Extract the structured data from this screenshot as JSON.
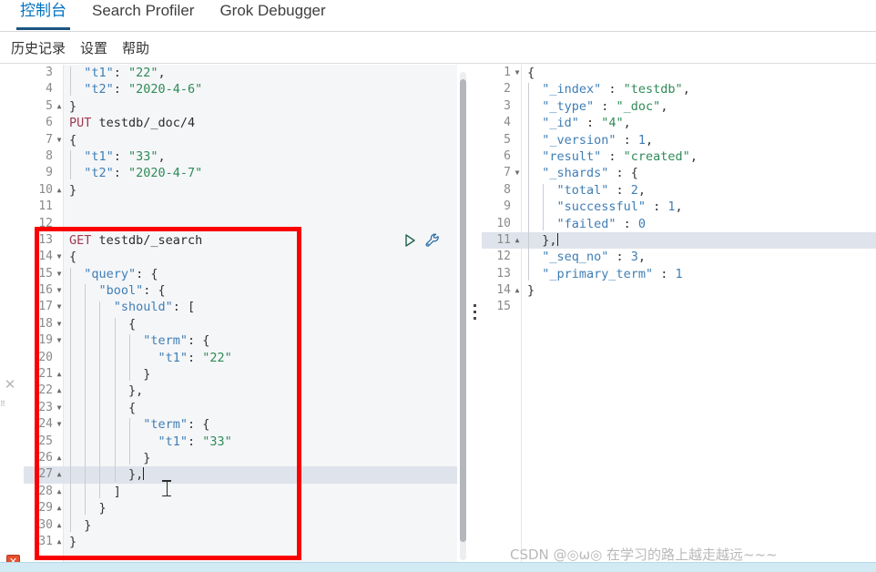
{
  "topbar": {
    "tabs": [
      {
        "label": "控制台",
        "active": true
      },
      {
        "label": "Search Profiler",
        "active": false
      },
      {
        "label": "Grok Debugger",
        "active": false
      }
    ]
  },
  "menubar": {
    "items": [
      {
        "label": "历史记录"
      },
      {
        "label": "设置"
      },
      {
        "label": "帮助"
      }
    ]
  },
  "editor_left": {
    "name": "request-editor",
    "actions": {
      "play": "play-request-icon",
      "wrench": "wrench-settings-icon"
    },
    "error_marker": "✕",
    "close_marker": "✕",
    "highlighted_line": 27,
    "cursor_line": 27,
    "lines": [
      {
        "num": 3,
        "fold": "",
        "indent": 1,
        "tokens": [
          {
            "t": "\"t1\"",
            "c": "k-key"
          },
          {
            "t": ": ",
            "c": "k-punc"
          },
          {
            "t": "\"22\"",
            "c": "k-str"
          },
          {
            "t": ",",
            "c": "k-punc"
          }
        ]
      },
      {
        "num": 4,
        "fold": "",
        "indent": 1,
        "tokens": [
          {
            "t": "\"t2\"",
            "c": "k-key"
          },
          {
            "t": ": ",
            "c": "k-punc"
          },
          {
            "t": "\"2020-4-6\"",
            "c": "k-str"
          }
        ]
      },
      {
        "num": 5,
        "fold": "▲",
        "indent": 0,
        "tokens": [
          {
            "t": "}",
            "c": "k-punc"
          }
        ]
      },
      {
        "num": 6,
        "fold": "",
        "indent": 0,
        "tokens": [
          {
            "t": "PUT",
            "c": "k-method"
          },
          {
            "t": " testdb/_doc/4",
            "c": "k-url"
          }
        ]
      },
      {
        "num": 7,
        "fold": "▼",
        "indent": 0,
        "tokens": [
          {
            "t": "{",
            "c": "k-punc"
          }
        ]
      },
      {
        "num": 8,
        "fold": "",
        "indent": 1,
        "tokens": [
          {
            "t": "\"t1\"",
            "c": "k-key"
          },
          {
            "t": ": ",
            "c": "k-punc"
          },
          {
            "t": "\"33\"",
            "c": "k-str"
          },
          {
            "t": ",",
            "c": "k-punc"
          }
        ]
      },
      {
        "num": 9,
        "fold": "",
        "indent": 1,
        "tokens": [
          {
            "t": "\"t2\"",
            "c": "k-key"
          },
          {
            "t": ": ",
            "c": "k-punc"
          },
          {
            "t": "\"2020-4-7\"",
            "c": "k-str"
          }
        ]
      },
      {
        "num": 10,
        "fold": "▲",
        "indent": 0,
        "tokens": [
          {
            "t": "}",
            "c": "k-punc"
          }
        ]
      },
      {
        "num": 11,
        "fold": "",
        "indent": 0,
        "tokens": []
      },
      {
        "num": 12,
        "fold": "",
        "indent": 0,
        "tokens": []
      },
      {
        "num": 13,
        "fold": "",
        "indent": 0,
        "tokens": [
          {
            "t": "GET",
            "c": "k-method"
          },
          {
            "t": " testdb/_search",
            "c": "k-url"
          }
        ]
      },
      {
        "num": 14,
        "fold": "▼",
        "indent": 0,
        "tokens": [
          {
            "t": "{",
            "c": "k-punc"
          }
        ]
      },
      {
        "num": 15,
        "fold": "▼",
        "indent": 1,
        "tokens": [
          {
            "t": "\"query\"",
            "c": "k-key"
          },
          {
            "t": ": {",
            "c": "k-punc"
          }
        ]
      },
      {
        "num": 16,
        "fold": "▼",
        "indent": 2,
        "tokens": [
          {
            "t": "\"bool\"",
            "c": "k-key"
          },
          {
            "t": ": {",
            "c": "k-punc"
          }
        ]
      },
      {
        "num": 17,
        "fold": "▼",
        "indent": 3,
        "tokens": [
          {
            "t": "\"should\"",
            "c": "k-key"
          },
          {
            "t": ": [",
            "c": "k-punc"
          }
        ]
      },
      {
        "num": 18,
        "fold": "▼",
        "indent": 4,
        "tokens": [
          {
            "t": "{",
            "c": "k-punc"
          }
        ]
      },
      {
        "num": 19,
        "fold": "▼",
        "indent": 5,
        "tokens": [
          {
            "t": "\"term\"",
            "c": "k-key"
          },
          {
            "t": ": {",
            "c": "k-punc"
          }
        ]
      },
      {
        "num": 20,
        "fold": "",
        "indent": 6,
        "tokens": [
          {
            "t": "\"t1\"",
            "c": "k-key"
          },
          {
            "t": ": ",
            "c": "k-punc"
          },
          {
            "t": "\"22\"",
            "c": "k-str"
          }
        ]
      },
      {
        "num": 21,
        "fold": "▲",
        "indent": 5,
        "tokens": [
          {
            "t": "}",
            "c": "k-punc"
          }
        ]
      },
      {
        "num": 22,
        "fold": "▲",
        "indent": 4,
        "tokens": [
          {
            "t": "},",
            "c": "k-punc"
          }
        ]
      },
      {
        "num": 23,
        "fold": "▼",
        "indent": 4,
        "tokens": [
          {
            "t": "{",
            "c": "k-punc"
          }
        ]
      },
      {
        "num": 24,
        "fold": "▼",
        "indent": 5,
        "tokens": [
          {
            "t": "\"term\"",
            "c": "k-key"
          },
          {
            "t": ": {",
            "c": "k-punc"
          }
        ]
      },
      {
        "num": 25,
        "fold": "",
        "indent": 6,
        "tokens": [
          {
            "t": "\"t1\"",
            "c": "k-key"
          },
          {
            "t": ": ",
            "c": "k-punc"
          },
          {
            "t": "\"33\"",
            "c": "k-str"
          }
        ]
      },
      {
        "num": 26,
        "fold": "▲",
        "indent": 5,
        "tokens": [
          {
            "t": "}",
            "c": "k-punc"
          }
        ]
      },
      {
        "num": 27,
        "fold": "▲",
        "indent": 4,
        "tokens": [
          {
            "t": "},",
            "c": "k-punc"
          }
        ]
      },
      {
        "num": 28,
        "fold": "▲",
        "indent": 3,
        "tokens": [
          {
            "t": "]",
            "c": "k-punc"
          }
        ]
      },
      {
        "num": 29,
        "fold": "▲",
        "indent": 2,
        "tokens": [
          {
            "t": "}",
            "c": "k-punc"
          }
        ]
      },
      {
        "num": 30,
        "fold": "▲",
        "indent": 1,
        "tokens": [
          {
            "t": "}",
            "c": "k-punc"
          }
        ]
      },
      {
        "num": 31,
        "fold": "▲",
        "indent": 0,
        "tokens": [
          {
            "t": "}",
            "c": "k-punc"
          }
        ]
      }
    ]
  },
  "editor_right": {
    "name": "response-viewer",
    "highlighted_line": 11,
    "lines": [
      {
        "num": 1,
        "fold": "▼",
        "indent": 0,
        "tokens": [
          {
            "t": "{",
            "c": "k-punc"
          }
        ]
      },
      {
        "num": 2,
        "fold": "",
        "indent": 1,
        "tokens": [
          {
            "t": "\"_index\"",
            "c": "k-key"
          },
          {
            "t": " : ",
            "c": "k-punc"
          },
          {
            "t": "\"testdb\"",
            "c": "k-str"
          },
          {
            "t": ",",
            "c": "k-punc"
          }
        ]
      },
      {
        "num": 3,
        "fold": "",
        "indent": 1,
        "tokens": [
          {
            "t": "\"_type\"",
            "c": "k-key"
          },
          {
            "t": " : ",
            "c": "k-punc"
          },
          {
            "t": "\"_doc\"",
            "c": "k-str"
          },
          {
            "t": ",",
            "c": "k-punc"
          }
        ]
      },
      {
        "num": 4,
        "fold": "",
        "indent": 1,
        "tokens": [
          {
            "t": "\"_id\"",
            "c": "k-key"
          },
          {
            "t": " : ",
            "c": "k-punc"
          },
          {
            "t": "\"4\"",
            "c": "k-str"
          },
          {
            "t": ",",
            "c": "k-punc"
          }
        ]
      },
      {
        "num": 5,
        "fold": "",
        "indent": 1,
        "tokens": [
          {
            "t": "\"_version\"",
            "c": "k-key"
          },
          {
            "t": " : ",
            "c": "k-punc"
          },
          {
            "t": "1",
            "c": "k-num"
          },
          {
            "t": ",",
            "c": "k-punc"
          }
        ]
      },
      {
        "num": 6,
        "fold": "",
        "indent": 1,
        "tokens": [
          {
            "t": "\"result\"",
            "c": "k-key"
          },
          {
            "t": " : ",
            "c": "k-punc"
          },
          {
            "t": "\"created\"",
            "c": "k-str"
          },
          {
            "t": ",",
            "c": "k-punc"
          }
        ]
      },
      {
        "num": 7,
        "fold": "▼",
        "indent": 1,
        "tokens": [
          {
            "t": "\"_shards\"",
            "c": "k-key"
          },
          {
            "t": " : {",
            "c": "k-punc"
          }
        ]
      },
      {
        "num": 8,
        "fold": "",
        "indent": 2,
        "tokens": [
          {
            "t": "\"total\"",
            "c": "k-key"
          },
          {
            "t": " : ",
            "c": "k-punc"
          },
          {
            "t": "2",
            "c": "k-num"
          },
          {
            "t": ",",
            "c": "k-punc"
          }
        ]
      },
      {
        "num": 9,
        "fold": "",
        "indent": 2,
        "tokens": [
          {
            "t": "\"successful\"",
            "c": "k-key"
          },
          {
            "t": " : ",
            "c": "k-punc"
          },
          {
            "t": "1",
            "c": "k-num"
          },
          {
            "t": ",",
            "c": "k-punc"
          }
        ]
      },
      {
        "num": 10,
        "fold": "",
        "indent": 2,
        "tokens": [
          {
            "t": "\"failed\"",
            "c": "k-key"
          },
          {
            "t": " : ",
            "c": "k-punc"
          },
          {
            "t": "0",
            "c": "k-num"
          }
        ]
      },
      {
        "num": 11,
        "fold": "▲",
        "indent": 1,
        "tokens": [
          {
            "t": "},",
            "c": "k-punc"
          }
        ]
      },
      {
        "num": 12,
        "fold": "",
        "indent": 1,
        "tokens": [
          {
            "t": "\"_seq_no\"",
            "c": "k-key"
          },
          {
            "t": " : ",
            "c": "k-punc"
          },
          {
            "t": "3",
            "c": "k-num"
          },
          {
            "t": ",",
            "c": "k-punc"
          }
        ]
      },
      {
        "num": 13,
        "fold": "",
        "indent": 1,
        "tokens": [
          {
            "t": "\"_primary_term\"",
            "c": "k-key"
          },
          {
            "t": " : ",
            "c": "k-punc"
          },
          {
            "t": "1",
            "c": "k-num"
          }
        ]
      },
      {
        "num": 14,
        "fold": "▲",
        "indent": 0,
        "tokens": [
          {
            "t": "}",
            "c": "k-punc"
          }
        ]
      },
      {
        "num": 15,
        "fold": "",
        "indent": 0,
        "tokens": []
      }
    ]
  },
  "annotation": {
    "shape": "rectangle",
    "color": "#fa0000"
  },
  "watermark": {
    "text": "CSDN @◎ω◎ 在学习的路上越走越远~~~"
  }
}
